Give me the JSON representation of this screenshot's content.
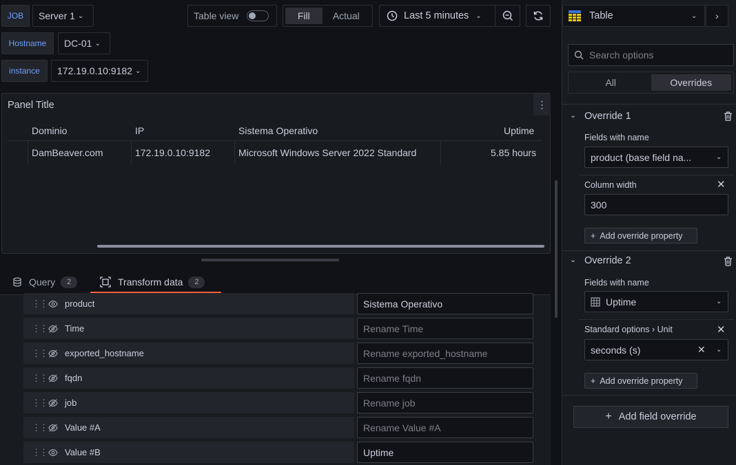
{
  "toolbar": {
    "job_label": "JOB",
    "job_value": "Server 1",
    "table_view_label": "Table view",
    "fill_label": "Fill",
    "actual_label": "Actual",
    "time_range": "Last 5 minutes",
    "viz_name": "Table"
  },
  "variables": {
    "hostname_label": "Hostname",
    "hostname_value": "DC-01",
    "instance_label": "instance",
    "instance_value": "172.19.0.10:9182"
  },
  "panel": {
    "title": "Panel Title",
    "columns": [
      "Dominio",
      "IP",
      "Sistema Operativo",
      "Uptime"
    ],
    "rows": [
      [
        "DamBeaver.com",
        "172.19.0.10:9182",
        "Microsoft Windows Server 2022 Standard",
        "5.85 hours"
      ]
    ]
  },
  "tabs": {
    "query_label": "Query",
    "query_count": "2",
    "transform_label": "Transform data",
    "transform_count": "2"
  },
  "fields": [
    {
      "name": "product",
      "visible": true,
      "value": "Sistema Operativo",
      "placeholder": ""
    },
    {
      "name": "Time",
      "visible": false,
      "value": "",
      "placeholder": "Rename Time"
    },
    {
      "name": "exported_hostname",
      "visible": false,
      "value": "",
      "placeholder": "Rename exported_hostname"
    },
    {
      "name": "fqdn",
      "visible": false,
      "value": "",
      "placeholder": "Rename fqdn"
    },
    {
      "name": "job",
      "visible": false,
      "value": "",
      "placeholder": "Rename job"
    },
    {
      "name": "Value #A",
      "visible": false,
      "value": "",
      "placeholder": "Rename Value #A"
    },
    {
      "name": "Value #B",
      "visible": true,
      "value": "Uptime",
      "placeholder": ""
    }
  ],
  "sidebar": {
    "search_placeholder": "Search options",
    "tab_all": "All",
    "tab_overrides": "Overrides",
    "override1": {
      "title": "Override 1",
      "matcher_label": "Fields with name",
      "matcher_value": "product (base field na...",
      "property_label": "Column width",
      "property_value": "300",
      "add_property": "Add override property"
    },
    "override2": {
      "title": "Override 2",
      "matcher_label": "Fields with name",
      "matcher_value": "Uptime",
      "property_label_group": "Standard options",
      "property_label_item": "Unit",
      "property_value": "seconds (s)",
      "add_property": "Add override property"
    },
    "add_field_override": "Add field override"
  }
}
